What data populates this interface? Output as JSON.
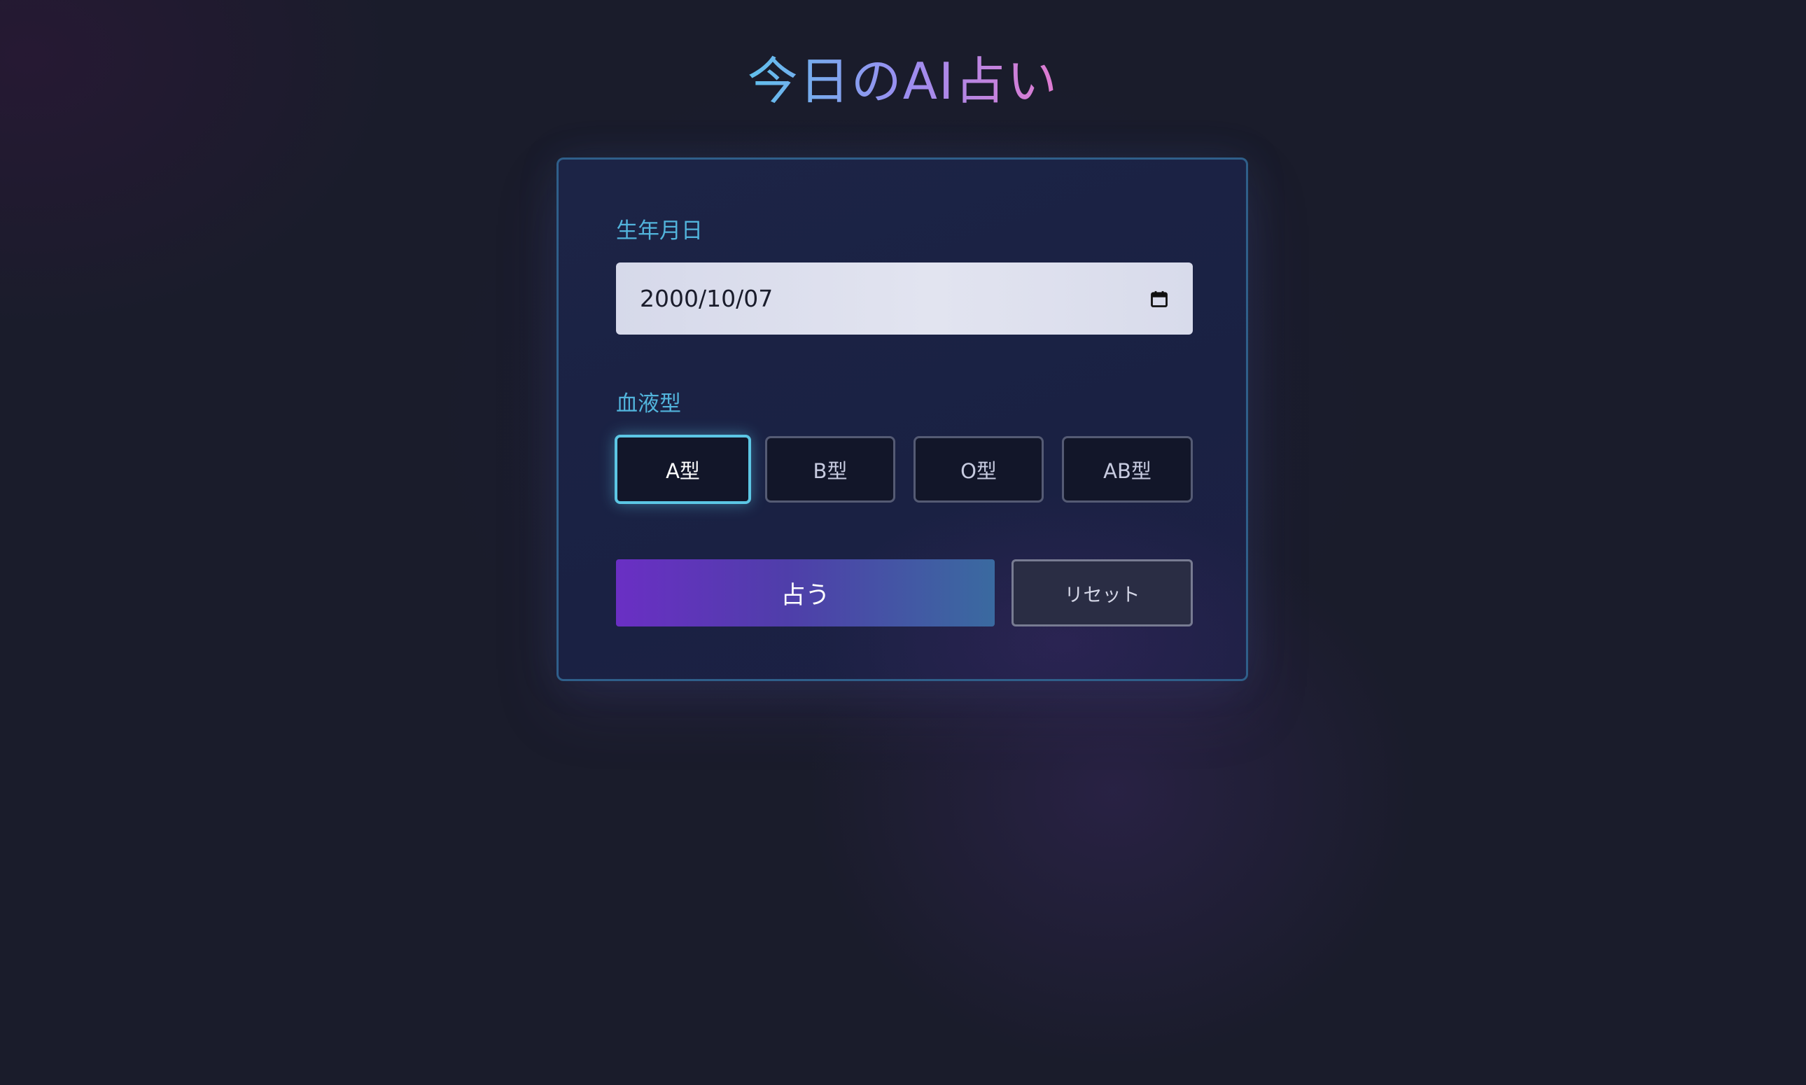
{
  "header": {
    "title": "今日のAI占い"
  },
  "form": {
    "birthdate": {
      "label": "生年月日",
      "value": "2000/10/07",
      "icon": "calendar-icon"
    },
    "blood_type": {
      "label": "血液型",
      "options": [
        "A型",
        "B型",
        "O型",
        "AB型"
      ],
      "selected": "A型"
    },
    "actions": {
      "submit_label": "占う",
      "reset_label": "リセット"
    }
  },
  "colors": {
    "label": "#52b4dc",
    "selected_border": "#5cc6e4",
    "submit_gradient_start": "#6a2fc4",
    "submit_gradient_end": "#3a6aa0",
    "title_gradient_start": "#5fc0ec",
    "title_gradient_end": "#e07ad0"
  }
}
